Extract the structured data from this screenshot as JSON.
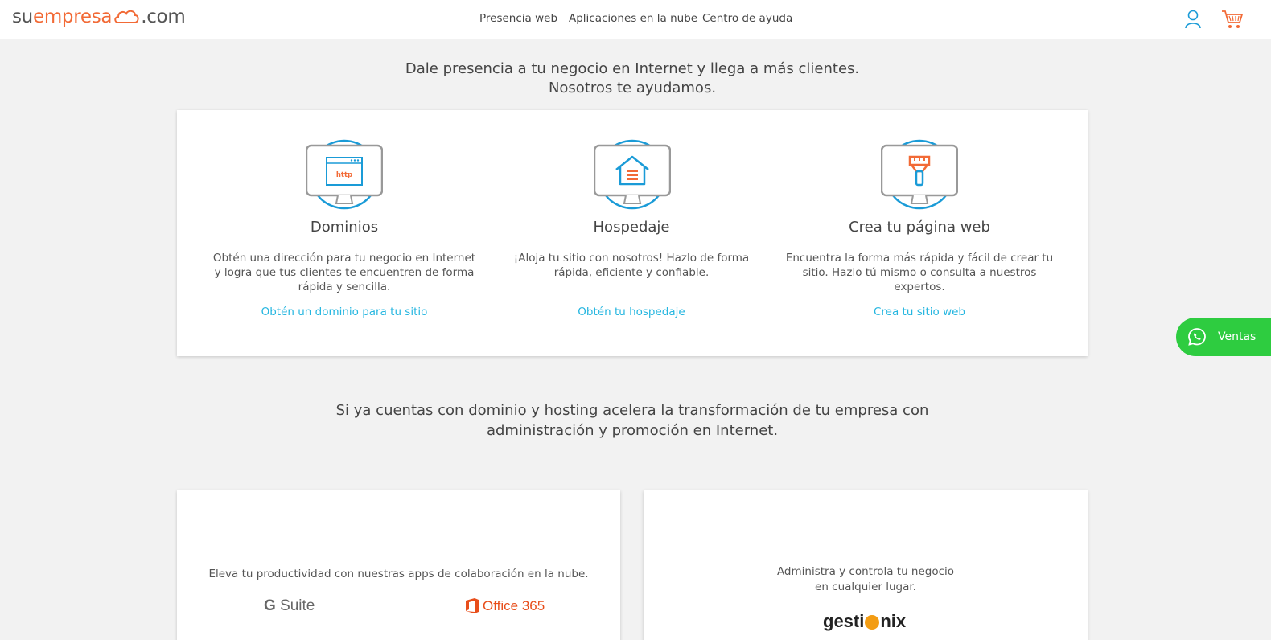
{
  "header": {
    "logo": {
      "part1": "su",
      "part2": "empresa",
      "part3": ".com"
    },
    "nav": [
      "Presencia web",
      "Aplicaciones en la nube",
      "Centro de ayuda"
    ],
    "icons": [
      "user-icon",
      "cart-icon"
    ]
  },
  "hero": {
    "line1": "Dale presencia a tu negocio en Internet y llega a más clientes.",
    "line2": "Nosotros te ayudamos."
  },
  "features": [
    {
      "icon": "domain-http-icon",
      "title": "Dominios",
      "description": "Obtén una dirección para tu negocio en Internet y logra que tus clientes te encuentren de forma rápida y sencilla.",
      "link": "Obtén un dominio para tu sitio"
    },
    {
      "icon": "hosting-house-icon",
      "title": "Hospedaje",
      "description": "¡Aloja tu sitio con nosotros! Hazlo de forma rápida, eficiente y confiable.",
      "link": "Obtén tu hospedaje"
    },
    {
      "icon": "paintbrush-icon",
      "title": "Crea tu página web",
      "description": "Encuentra la forma más rápida y fácil de crear tu sitio. Hazlo tú mismo o consulta a nuestros expertos.",
      "link": "Crea tu sitio web"
    }
  ],
  "sub": {
    "line1": "Si ya cuentas con dominio y hosting acelera la transformación de tu empresa con",
    "line2": "administración y promoción en Internet."
  },
  "gsuite_card": {
    "description": "Eleva tu productividad con nuestras apps de colaboración en la nube.",
    "logo1_g": "G",
    "logo1_text": "Suite",
    "logo2": "Office 365"
  },
  "gestionix_card": {
    "line1": "Administra y controla tu negocio",
    "line2": "en cualquier lugar.",
    "logo_a": "gesti",
    "logo_b": "nix"
  },
  "ventas": {
    "label": "Ventas"
  },
  "colors": {
    "brand_orange": "#f26a36",
    "link_blue": "#25b6e0",
    "icon_blue": "#1a9bd7",
    "whatsapp_green": "#2ecc40"
  }
}
